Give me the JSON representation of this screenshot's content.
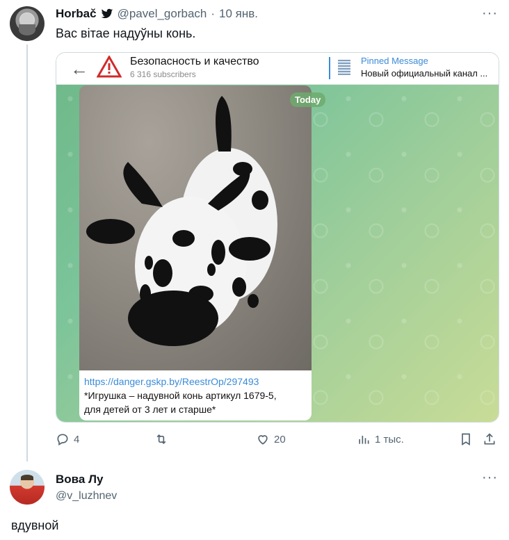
{
  "tweet1": {
    "name": "Horbač",
    "handle": "@pavel_gorbach",
    "separator": "·",
    "date": "10 янв.",
    "text": "Вас вітае надуўны конь.",
    "more": "···",
    "embed": {
      "channel_name": "Безопасность и качество",
      "subscribers": "6 316 subscribers",
      "pinned_label": "Pinned Message",
      "pinned_text": "Новый официальный канал ...",
      "today": "Today",
      "link": "https://danger.gskp.by/ReestrOp/297493",
      "caption_line1": "*Игрушка – надувной конь артикул 1679-5,",
      "caption_line2": "для детей от 3 лет и старше*"
    },
    "actions": {
      "replies": "4",
      "retweets": "",
      "likes": "20",
      "views": "1 тыс."
    }
  },
  "tweet2": {
    "name": "Вова Лу",
    "handle": "@v_luzhnev",
    "more": "···",
    "text": "вдувной"
  },
  "colors": {
    "link": "#3a8bd8",
    "secondary": "#536471",
    "thread_line": "#cfd9de",
    "twitter_blue": "#1d9bf0"
  }
}
